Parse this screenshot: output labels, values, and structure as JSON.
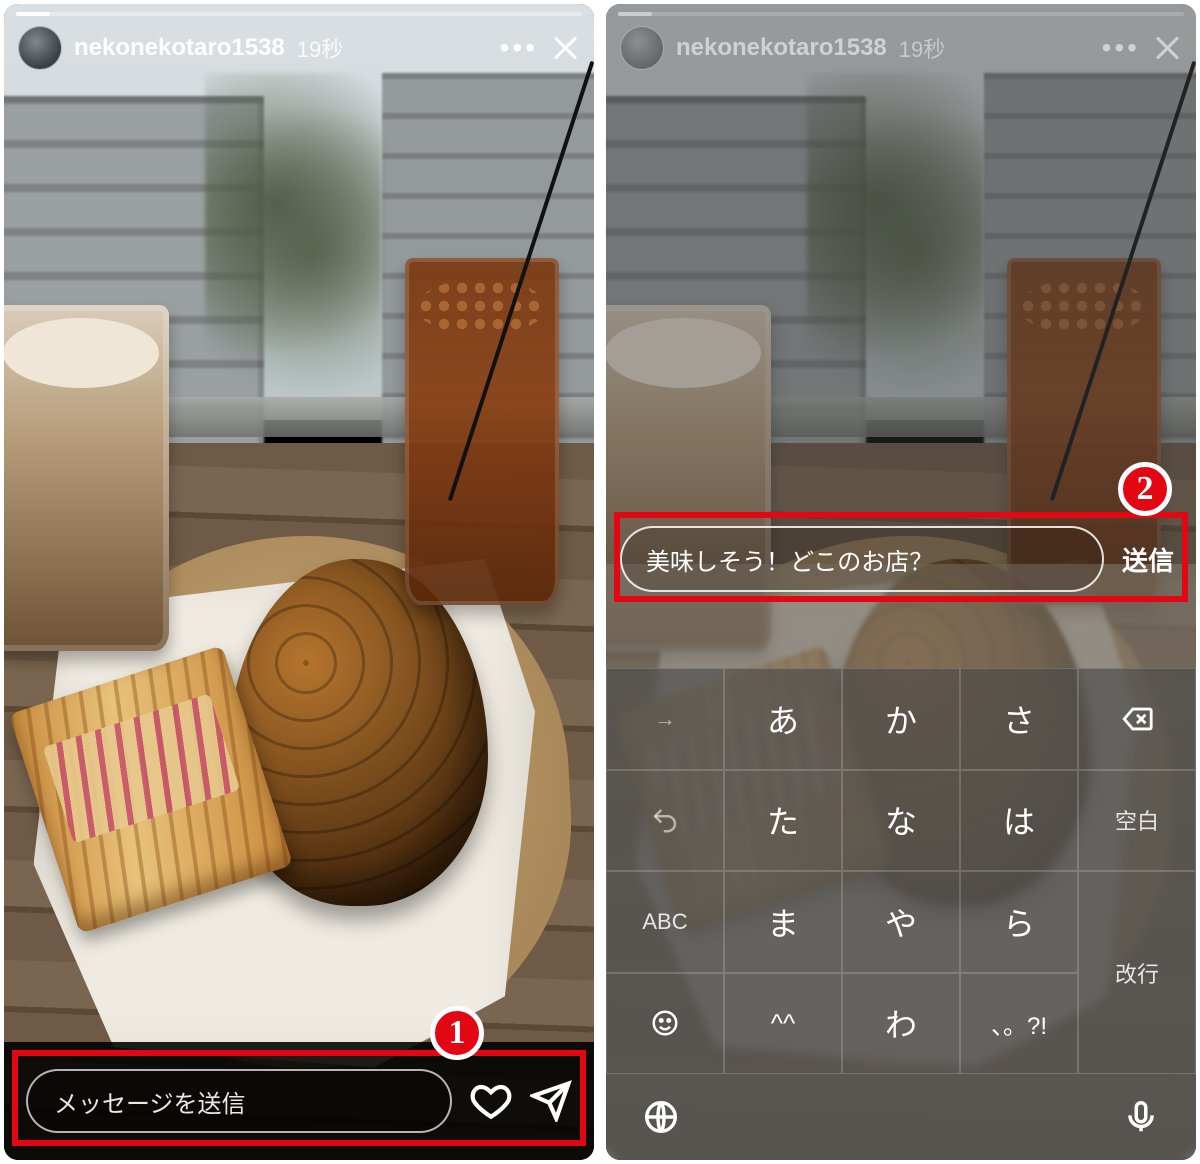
{
  "annotations": {
    "badge1": "1",
    "badge2": "2"
  },
  "left": {
    "username": "nekonekotaro1538",
    "timestamp": "19秒",
    "more": "•••",
    "message_placeholder": "メッセージを送信"
  },
  "right": {
    "username": "nekonekotaro1538",
    "timestamp": "19秒",
    "more": "•••",
    "reply_text": "美味しそう！どこのお店？",
    "send_label": "送信",
    "keyboard": {
      "rows": [
        [
          "→",
          "あ",
          "か",
          "さ",
          "⌫"
        ],
        [
          "↶",
          "た",
          "な",
          "は",
          "空白"
        ],
        [
          "ABC",
          "ま",
          "や",
          "ら",
          "改行"
        ],
        [
          "☺",
          "^^",
          "わ",
          "、。?!",
          ""
        ]
      ],
      "space_label": "空白",
      "return_label": "改行",
      "abc_label": "ABC"
    }
  }
}
